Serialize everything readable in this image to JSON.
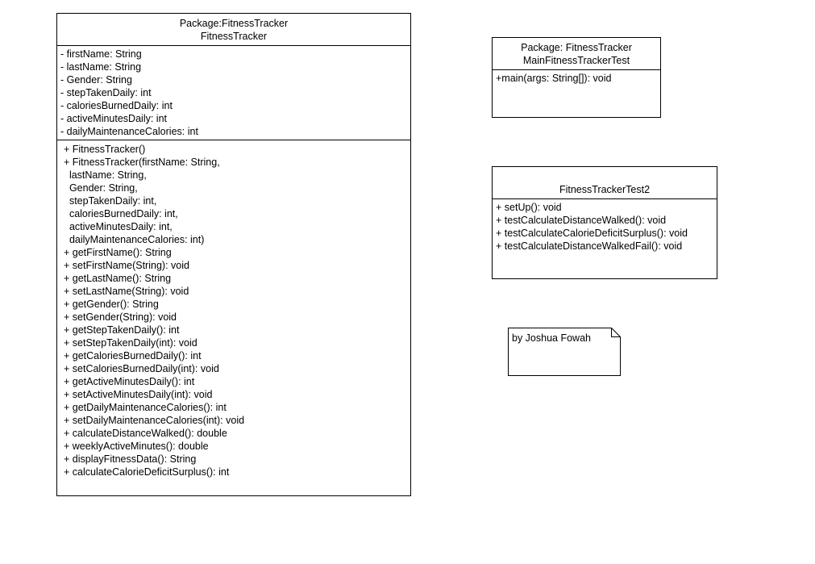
{
  "classes": {
    "fitness_tracker": {
      "package": "Package:FitnessTracker",
      "name": "FitnessTracker",
      "attributes": [
        "- firstName: String",
        "- lastName: String",
        "- Gender: String",
        "- stepTakenDaily: int",
        "- caloriesBurnedDaily: int",
        "- activeMinutesDaily: int",
        "- dailyMaintenanceCalories: int"
      ],
      "operations": [
        "+ FitnessTracker()",
        "+ FitnessTracker(firstName: String,",
        "  lastName: String,",
        "  Gender: String,",
        "  stepTakenDaily: int,",
        "  caloriesBurnedDaily: int,",
        "  activeMinutesDaily: int,",
        "  dailyMaintenanceCalories: int)",
        "+ getFirstName(): String",
        "+ setFirstName(String): void",
        "+ getLastName(): String",
        "+ setLastName(String): void",
        "+ getGender(): String",
        "+ setGender(String): void",
        "+ getStepTakenDaily(): int",
        "+ setStepTakenDaily(int): void",
        "+ getCaloriesBurnedDaily(): int",
        "+ setCaloriesBurnedDaily(int): void",
        "+ getActiveMinutesDaily(): int",
        "+ setActiveMinutesDaily(int): void",
        "+ getDailyMaintenanceCalories(): int",
        "+ setDailyMaintenanceCalories(int): void",
        "+ calculateDistanceWalked(): double",
        "+ weeklyActiveMinutes(): double",
        "+ displayFitnessData(): String",
        "+ calculateCalorieDeficitSurplus(): int"
      ]
    },
    "main_test": {
      "package": "Package: FitnessTracker",
      "name": "MainFitnessTrackerTest",
      "operations": [
        "+main(args: String[]): void"
      ]
    },
    "test2": {
      "name": "FitnessTrackerTest2",
      "operations": [
        "+ setUp(): void",
        "+ testCalculateDistanceWalked(): void",
        "+ testCalculateCalorieDeficitSurplus(): void",
        "+ testCalculateDistanceWalkedFail(): void"
      ]
    }
  },
  "note": {
    "text": "by Joshua Fowah"
  }
}
